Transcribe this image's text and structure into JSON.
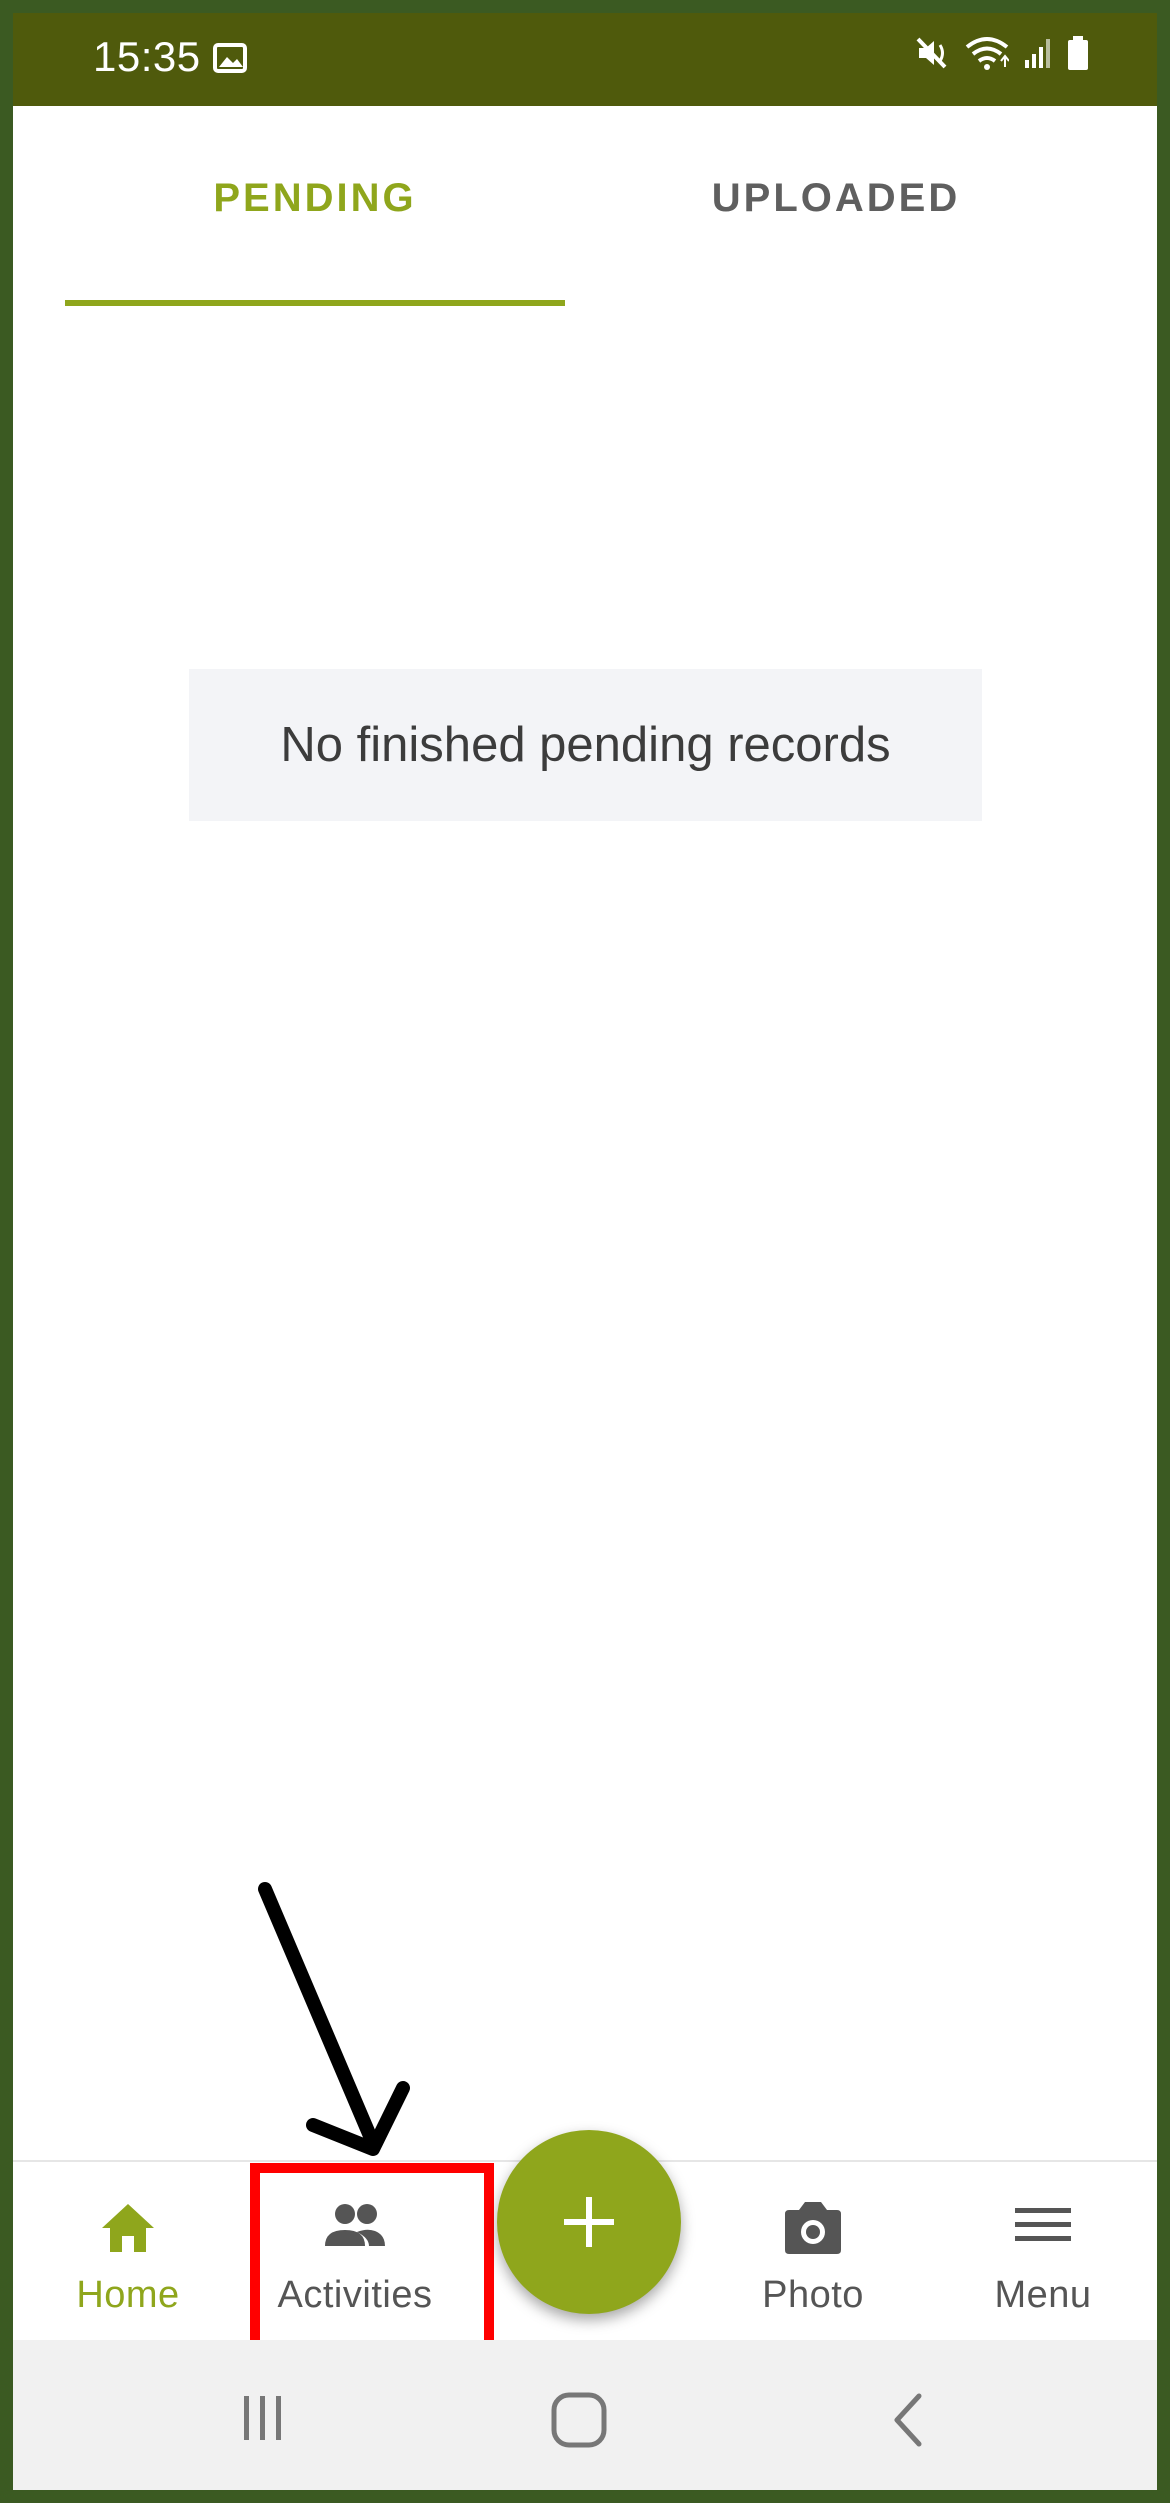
{
  "status_bar": {
    "time": "15:35",
    "icons": [
      "gallery-icon",
      "mute-icon",
      "wifi-icon",
      "signal-icon",
      "battery-icon"
    ]
  },
  "tabs": [
    {
      "label": "PENDING",
      "active": true
    },
    {
      "label": "UPLOADED",
      "active": false
    }
  ],
  "main": {
    "empty_message": "No finished pending records"
  },
  "bottom_nav": {
    "items": [
      {
        "label": "Home",
        "icon": "home-icon",
        "active": true
      },
      {
        "label": "Activities",
        "icon": "people-icon",
        "active": false
      },
      {
        "label": "Photo",
        "icon": "camera-icon",
        "active": false
      },
      {
        "label": "Menu",
        "icon": "menu-icon",
        "active": false
      }
    ],
    "fab_icon": "plus-icon"
  },
  "system_nav": {
    "icons": [
      "recent-apps-icon",
      "home-button-icon",
      "back-icon"
    ]
  },
  "colors": {
    "accent": "#8fa61c",
    "status_bar": "#4f5a0c",
    "frame": "#3b5a22",
    "highlight": "#ff0000"
  }
}
